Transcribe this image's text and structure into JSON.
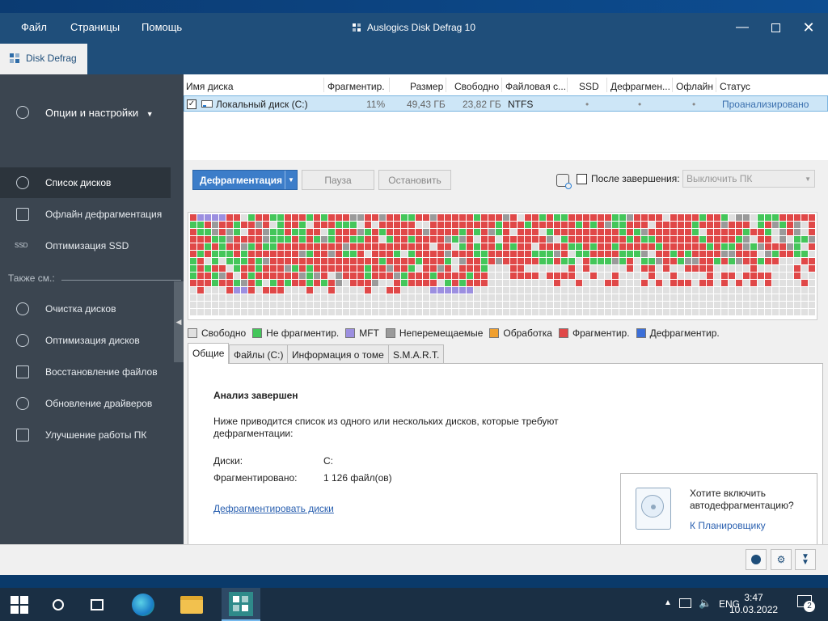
{
  "window": {
    "title": "Auslogics Disk Defrag 10",
    "menu": [
      "Файл",
      "Страницы",
      "Помощь"
    ],
    "tab_label": "Disk Defrag"
  },
  "sidebar": {
    "options_label": "Опции и настройки",
    "items": [
      {
        "label": "Список дисков",
        "icon": "disk-list-icon",
        "active": true
      },
      {
        "label": "Офлайн дефрагментация",
        "icon": "offline-defrag-icon"
      },
      {
        "label": "Оптимизация SSD",
        "icon": "ssd-icon",
        "glyph": "SSD"
      }
    ],
    "also_label": "Также см.:",
    "tools": [
      {
        "label": "Очистка дисков",
        "icon": "disk-cleanup-icon"
      },
      {
        "label": "Оптимизация дисков",
        "icon": "disk-optimize-icon"
      },
      {
        "label": "Восстановление файлов",
        "icon": "file-recovery-icon"
      },
      {
        "label": "Обновление драйверов",
        "icon": "driver-update-icon"
      },
      {
        "label": "Улучшение работы ПК",
        "icon": "pc-boost-icon"
      }
    ]
  },
  "drive_list": {
    "columns": [
      "Имя диска",
      "Фрагментир.",
      "Размер",
      "Свободно",
      "Файловая с...",
      "SSD",
      "Дефрагмен...",
      "Офлайн",
      "Статус"
    ],
    "rows": [
      {
        "checked": true,
        "name": "Локальный диск (C:)",
        "fragmented": "11%",
        "size": "49,43 ГБ",
        "free": "23,82 ГБ",
        "filesystem": "NTFS",
        "ssd": "•",
        "defrag": "•",
        "offline": "•",
        "status": "Проанализировано"
      }
    ]
  },
  "actions": {
    "defrag_label": "Дефрагментация",
    "pause_label": "Пауза",
    "stop_label": "Остановить",
    "after_label": "После завершения:",
    "after_checked": false,
    "after_select_value": "Выключить ПК"
  },
  "legend": [
    {
      "label": "Свободно",
      "color": "#e0e0e0"
    },
    {
      "label": "Не фрагментир.",
      "color": "#44c65a"
    },
    {
      "label": "MFT",
      "color": "#9c8fe0"
    },
    {
      "label": "Неперемещаемые",
      "color": "#9a9a9a"
    },
    {
      "label": "Обработка",
      "color": "#f0a030"
    },
    {
      "label": "Фрагментир.",
      "color": "#e04848"
    },
    {
      "label": "Дефрагментир.",
      "color": "#3c6fd8"
    }
  ],
  "tabs": [
    "Общие",
    "Файлы (C:)",
    "Информация о томе",
    "S.M.A.R.T."
  ],
  "summary": {
    "heading": "Анализ завершен",
    "description": "Ниже приводится список из одного или нескольких дисков, которые требуют дефрагментации:",
    "disks_label": "Диски:",
    "disks_value": "C:",
    "fragmented_label": "Фрагментировано:",
    "fragmented_value": "1 126 файл(ов)",
    "action_link": "Дефрагментировать диски"
  },
  "promo": {
    "text": "Хотите включить автодефрагментацию?",
    "link": "К Планировщику"
  },
  "taskbar": {
    "language": "ENG",
    "time": "3:47",
    "date": "10.03.2022",
    "notifications": "2"
  }
}
